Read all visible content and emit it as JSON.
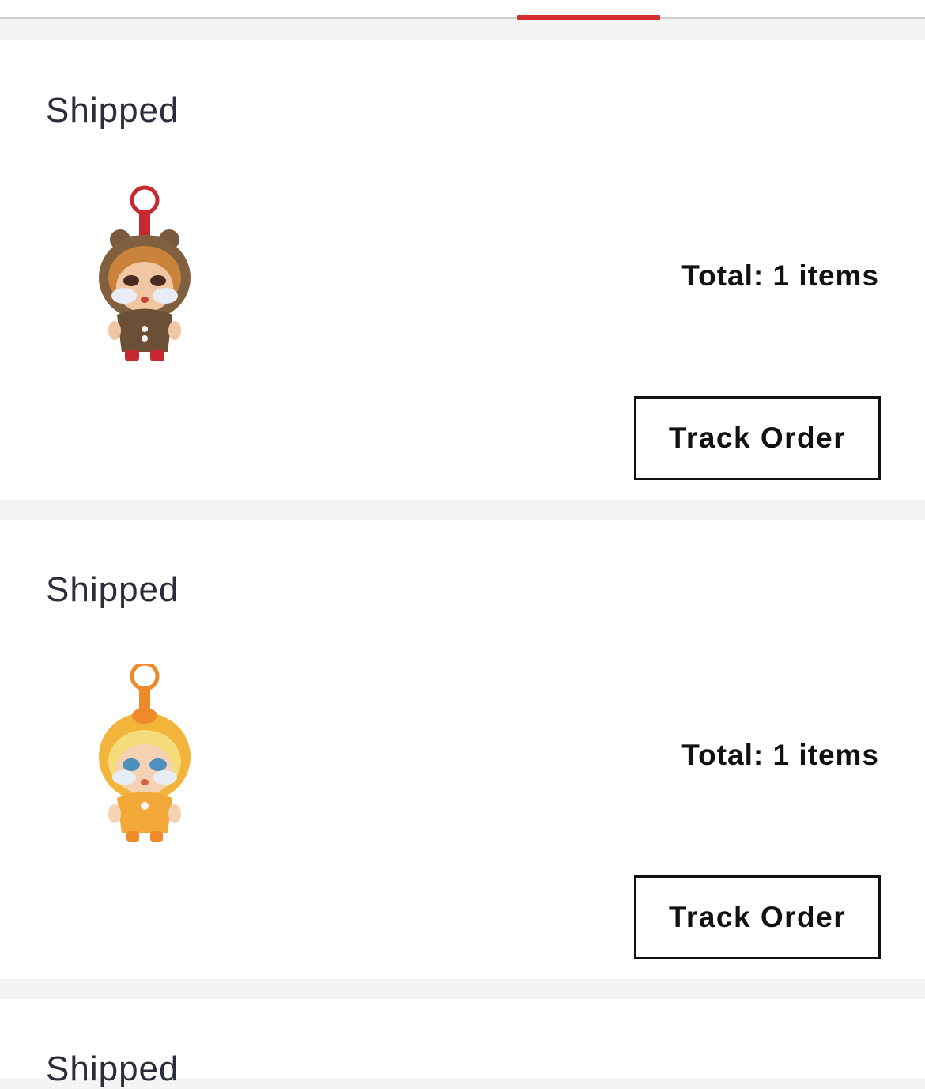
{
  "tab_indicator_color": "#d32f2f",
  "orders": [
    {
      "status": "Shipped",
      "product_icon": "red-bear-doll-keychain-icon",
      "total": "Total: 1 items",
      "action_label": "Track Order"
    },
    {
      "status": "Shipped",
      "product_icon": "yellow-duck-doll-keychain-icon",
      "total": "Total: 1 items",
      "action_label": "Track Order"
    },
    {
      "status": "Shipped"
    }
  ]
}
